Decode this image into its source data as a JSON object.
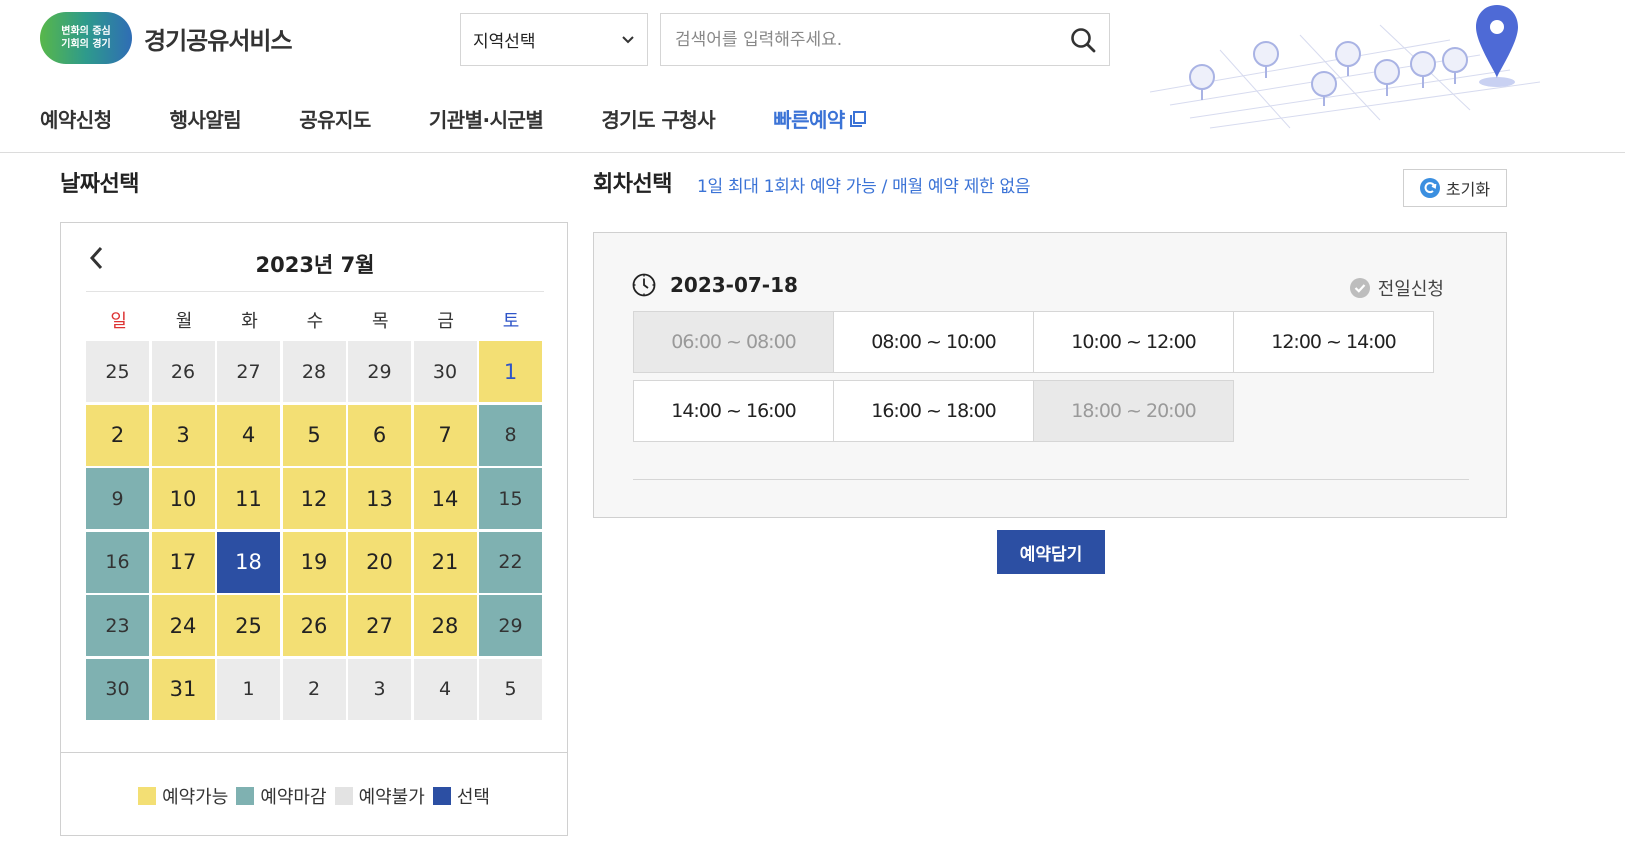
{
  "header": {
    "logo_badge_line1": "변화의 중심",
    "logo_badge_line2": "기회의 경기",
    "logo_text": "경기공유서비스",
    "region_select": "지역선택",
    "search_placeholder": "검색어를 입력해주세요.",
    "nav": [
      "예약신청",
      "행사알림",
      "공유지도",
      "기관별·시군별",
      "경기도 구청사",
      "빠른예약"
    ]
  },
  "date_section": {
    "title": "날짜선택",
    "month": "2023년 7월",
    "dow": [
      "일",
      "월",
      "화",
      "수",
      "목",
      "금",
      "토"
    ],
    "days": [
      {
        "d": "25",
        "s": "na"
      },
      {
        "d": "26",
        "s": "na"
      },
      {
        "d": "27",
        "s": "na"
      },
      {
        "d": "28",
        "s": "na"
      },
      {
        "d": "29",
        "s": "na"
      },
      {
        "d": "30",
        "s": "na"
      },
      {
        "d": "1",
        "s": "avail",
        "blue": true
      },
      {
        "d": "2",
        "s": "avail"
      },
      {
        "d": "3",
        "s": "avail"
      },
      {
        "d": "4",
        "s": "avail"
      },
      {
        "d": "5",
        "s": "avail"
      },
      {
        "d": "6",
        "s": "avail"
      },
      {
        "d": "7",
        "s": "avail"
      },
      {
        "d": "8",
        "s": "closed"
      },
      {
        "d": "9",
        "s": "closed"
      },
      {
        "d": "10",
        "s": "avail"
      },
      {
        "d": "11",
        "s": "avail"
      },
      {
        "d": "12",
        "s": "avail"
      },
      {
        "d": "13",
        "s": "avail"
      },
      {
        "d": "14",
        "s": "avail"
      },
      {
        "d": "15",
        "s": "closed"
      },
      {
        "d": "16",
        "s": "closed"
      },
      {
        "d": "17",
        "s": "avail"
      },
      {
        "d": "18",
        "s": "sel"
      },
      {
        "d": "19",
        "s": "avail"
      },
      {
        "d": "20",
        "s": "avail"
      },
      {
        "d": "21",
        "s": "avail"
      },
      {
        "d": "22",
        "s": "closed"
      },
      {
        "d": "23",
        "s": "closed"
      },
      {
        "d": "24",
        "s": "avail"
      },
      {
        "d": "25",
        "s": "avail"
      },
      {
        "d": "26",
        "s": "avail"
      },
      {
        "d": "27",
        "s": "avail"
      },
      {
        "d": "28",
        "s": "avail"
      },
      {
        "d": "29",
        "s": "closed"
      },
      {
        "d": "30",
        "s": "closed"
      },
      {
        "d": "31",
        "s": "avail"
      },
      {
        "d": "1",
        "s": "na"
      },
      {
        "d": "2",
        "s": "na"
      },
      {
        "d": "3",
        "s": "na"
      },
      {
        "d": "4",
        "s": "na"
      },
      {
        "d": "5",
        "s": "na"
      }
    ],
    "legend": [
      {
        "label": "예약가능",
        "color": "#f3df74"
      },
      {
        "label": "예약마감",
        "color": "#7fb1b1"
      },
      {
        "label": "예약불가",
        "color": "#e3e3e3"
      },
      {
        "label": "선택",
        "color": "#2c4fa3"
      }
    ]
  },
  "round_section": {
    "title": "회차선택",
    "note": "1일 최대 1회차 예약 가능 / 매월 예약 제한 없음",
    "reset_label": "초기화",
    "date": "2023-07-18",
    "all_day_label": "전일신청",
    "slots": [
      {
        "time": "06:00 ~ 08:00",
        "disabled": true
      },
      {
        "time": "08:00 ~ 10:00",
        "disabled": false
      },
      {
        "time": "10:00 ~ 12:00",
        "disabled": false
      },
      {
        "time": "12:00 ~ 14:00",
        "disabled": false
      },
      {
        "time": "14:00 ~ 16:00",
        "disabled": false
      },
      {
        "time": "16:00 ~ 18:00",
        "disabled": false
      },
      {
        "time": "18:00 ~ 20:00",
        "disabled": true
      }
    ],
    "reserve_label": "예약담기"
  },
  "colors": {
    "available": "#f3df74",
    "closed": "#7fb1b1",
    "unavailable": "#ebebeb",
    "selected": "#2c4fa3",
    "accent": "#3b73d6"
  }
}
